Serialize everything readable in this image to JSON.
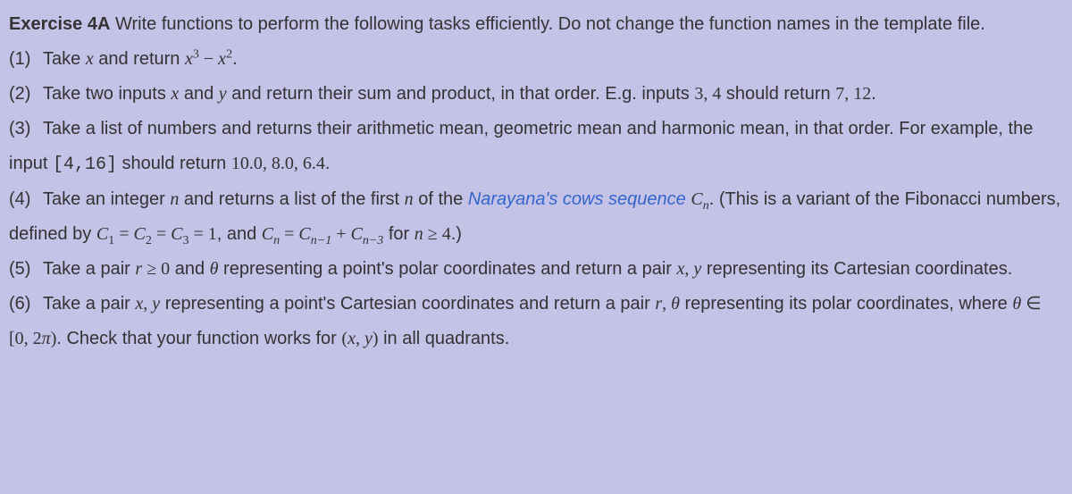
{
  "title_bold": "Exercise 4A",
  "title_rest": " Write functions to perform the following tasks efficiently. Do not change the function names in the template file.",
  "items": {
    "n1": "(1)",
    "t1a": "Take ",
    "t1b": " and return ",
    "t1_x": "x",
    "t1_x3": "x",
    "t1_p3": "3",
    "t1_minus": " − ",
    "t1_x2": "x",
    "t1_p2": "2",
    "t1_dot": ".",
    "n2": "(2)",
    "t2a": "Take two inputs ",
    "t2_x": "x",
    "t2b": " and ",
    "t2_y": "y",
    "t2c": " and return their sum and product, in that order. E.g. inputs ",
    "t2_34": "3, 4",
    "t2d": " should return ",
    "t2_712": "7, 12",
    "t2_dot": ".",
    "n3": "(3)",
    "t3a": "Take a list of numbers and returns their arithmetic mean, geometric mean and harmonic mean, in that order. For example, the input ",
    "t3_code": "[4,16]",
    "t3b": " should return ",
    "t3_vals": "10.0, 8.0, 6.4",
    "t3_dot": ".",
    "n4": "(4)",
    "t4a": "Take an integer ",
    "t4_n1": "n",
    "t4b": " and returns a list of the first ",
    "t4_n2": "n",
    "t4c": " of the ",
    "t4_link": "Narayana's cows sequence",
    "t4_sp": " ",
    "t4_C": "C",
    "t4_Csub": "n",
    "t4d": ". (This is a variant of the Fibonacci numbers, defined by ",
    "t4_eq1a": "C",
    "t4_eq1a_s": "1",
    "t4_eq": " = ",
    "t4_eq1b": "C",
    "t4_eq1b_s": "2",
    "t4_eq1c": "C",
    "t4_eq1c_s": "3",
    "t4_eq1d": " = 1",
    "t4_and": ", and ",
    "t4_eq2a": "C",
    "t4_eq2a_s": "n",
    "t4_eq2b": "C",
    "t4_eq2b_s": "n−1",
    "t4_plus": " + ",
    "t4_eq2c": "C",
    "t4_eq2c_s": "n−3",
    "t4_for": " for ",
    "t4_n3": "n",
    "t4_ge": " ≥ 4",
    "t4_end": ".)",
    "n5": "(5)",
    "t5a": "Take a pair ",
    "t5_r": "r",
    "t5_ge": " ≥ 0",
    "t5b": " and ",
    "t5_th": "θ",
    "t5c": " representing a point's polar coordinates and return a pair ",
    "t5_x": "x",
    "t5_cm": ", ",
    "t5_y": "y",
    "t5d": " representing its Cartesian coordinates.",
    "n6": "(6)",
    "t6a": "Take a pair ",
    "t6_x": "x",
    "t6_cm": ", ",
    "t6_y": "y",
    "t6b": " representing a point's Cartesian coordinates and return a pair ",
    "t6_r": "r",
    "t6_cm2": ", ",
    "t6_th": "θ",
    "t6c": " representing its polar coordinates, where ",
    "t6_th2": "θ",
    "t6_in": " ∈ [0, 2",
    "t6_pi": "π",
    "t6_cl": ")",
    "t6d": ". Check that your function works for ",
    "t6_op": "(",
    "t6_x2": "x",
    "t6_cm3": ", ",
    "t6_y2": "y",
    "t6_cl2": ")",
    "t6e": " in all quadrants."
  }
}
